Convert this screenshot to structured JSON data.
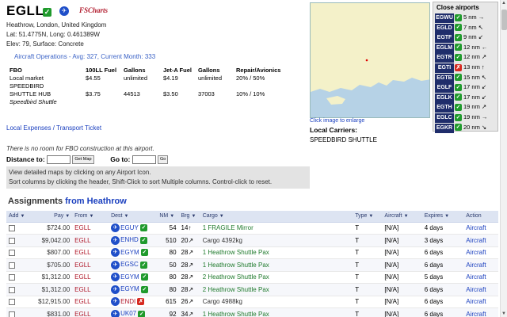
{
  "airport": {
    "icao": "EGLL",
    "fse_logo": "FSCharts",
    "name": "Heathrow, London, United Kingdom",
    "latlong": "Lat: 51.4775N, Long: 0.461389W",
    "elev": "Elev: 79, Surface: Concrete",
    "operations": "Aircraft Operations - Avg: 327, Current Month: 333"
  },
  "fbo": {
    "headers": [
      "FBO",
      "100LL Fuel",
      "Gallons",
      "Jet-A Fuel",
      "Gallons",
      "Repair/Avionics"
    ],
    "rows": [
      {
        "name": "Local market",
        "ll": "$4.55",
        "llg": "unlimited",
        "jet": "$4.19",
        "jetg": "unlimited",
        "repair": "20% / 50%"
      },
      {
        "name": "SPEEDBIRD",
        "ll": "",
        "llg": "",
        "jet": "",
        "jetg": "",
        "repair": ""
      },
      {
        "name": "SHUTTLE HUB",
        "ll": "$3.75",
        "llg": "44513",
        "jet": "$3.50",
        "jetg": "37003",
        "repair": "10% / 10%"
      },
      {
        "name": "Speedbird Shuttle",
        "ll": "",
        "llg": "",
        "jet": "",
        "jetg": "",
        "repair": ""
      }
    ],
    "links": "Local Expenses / Transport Ticket"
  },
  "map": {
    "caption": "Click image to enlarge",
    "carriers_label": "Local Carriers:",
    "carriers_value": "SPEEDBIRD SHUTTLE"
  },
  "close_airports": {
    "title": "Close airports",
    "items": [
      {
        "code": "EGWU",
        "status": "ok",
        "dist": "5 nm",
        "arrow": "→"
      },
      {
        "code": "EGLD",
        "status": "ok",
        "dist": "7 nm",
        "arrow": "↖"
      },
      {
        "code": "EGTF",
        "status": "ok",
        "dist": "9 nm",
        "arrow": "↙"
      },
      {
        "code": "EGLM",
        "status": "ok",
        "dist": "12 nm",
        "arrow": "←"
      },
      {
        "code": "EGTR",
        "status": "ok",
        "dist": "12 nm",
        "arrow": "↗"
      },
      {
        "code": "EGTI",
        "status": "x",
        "dist": "13 nm",
        "arrow": "↑"
      },
      {
        "code": "EGTB",
        "status": "ok",
        "dist": "15 nm",
        "arrow": "↖"
      },
      {
        "code": "EGLF",
        "status": "ok",
        "dist": "17 nm",
        "arrow": "↙"
      },
      {
        "code": "EGLK",
        "status": "ok",
        "dist": "17 nm",
        "arrow": "↙"
      },
      {
        "code": "EGTH",
        "status": "ok",
        "dist": "19 nm",
        "arrow": "↗"
      },
      {
        "code": "EGLC",
        "status": "ok",
        "dist": "19 nm",
        "arrow": "→"
      },
      {
        "code": "EGKR",
        "status": "ok",
        "dist": "20 nm",
        "arrow": "↘"
      }
    ]
  },
  "construction": {
    "notice": "There is no room for FBO construction at this airport.",
    "distance_label": "Distance to:",
    "get_map": "Get Map",
    "goto_label": "Go to:",
    "go": "Go",
    "help1": "View detailed maps by clicking on any Airport Icon.",
    "help2": "Sort columns by clicking the header, Shift-Click to sort Multiple columns. Control-click to reset."
  },
  "assignments": {
    "title_prefix": "Assignments",
    "title_link": "from Heathrow",
    "headers": [
      "Add",
      "Pay",
      "From",
      "Dest",
      "NM",
      "Brg",
      "Cargo",
      "Type",
      "Aircraft",
      "Expires",
      "Action"
    ],
    "rows": [
      {
        "pay": "$724.00",
        "from": "EGLL",
        "dest": "EGUY",
        "dest_status": "ok",
        "nm": "54",
        "brg": "14",
        "brg_arrow": "↑",
        "cargo": "1 FRAGILE Mirror",
        "cargo_link": true,
        "type": "T",
        "aircraft": "[N/A]",
        "expires": "4 days",
        "action": "Aircraft"
      },
      {
        "pay": "$9,042.00",
        "from": "EGLL",
        "dest": "ENHD",
        "dest_status": "ok",
        "nm": "510",
        "brg": "20",
        "brg_arrow": "↗",
        "cargo": "Cargo 4392kg",
        "cargo_link": false,
        "type": "T",
        "aircraft": "[N/A]",
        "expires": "3 days",
        "action": "Aircraft"
      },
      {
        "pay": "$807.00",
        "from": "EGLL",
        "dest": "EGYM",
        "dest_status": "ok",
        "nm": "80",
        "brg": "28",
        "brg_arrow": "↗",
        "cargo": "1 Heathrow Shuttle Pax",
        "cargo_link": true,
        "type": "T",
        "aircraft": "[N/A]",
        "expires": "6 days",
        "action": "Aircraft"
      },
      {
        "pay": "$705.00",
        "from": "EGLL",
        "dest": "EGSC",
        "dest_status": "ok",
        "nm": "50",
        "brg": "28",
        "brg_arrow": "↗",
        "cargo": "1 Heathrow Shuttle Pax",
        "cargo_link": true,
        "type": "T",
        "aircraft": "[N/A]",
        "expires": "6 days",
        "action": "Aircraft"
      },
      {
        "pay": "$1,312.00",
        "from": "EGLL",
        "dest": "EGYM",
        "dest_status": "ok",
        "nm": "80",
        "brg": "28",
        "brg_arrow": "↗",
        "cargo": "2 Heathrow Shuttle Pax",
        "cargo_link": true,
        "type": "T",
        "aircraft": "[N/A]",
        "expires": "5 days",
        "action": "Aircraft"
      },
      {
        "pay": "$1,312.00",
        "from": "EGLL",
        "dest": "EGYM",
        "dest_status": "ok",
        "nm": "80",
        "brg": "28",
        "brg_arrow": "↗",
        "cargo": "2 Heathrow Shuttle Pax",
        "cargo_link": true,
        "type": "T",
        "aircraft": "[N/A]",
        "expires": "6 days",
        "action": "Aircraft"
      },
      {
        "pay": "$12,915.00",
        "from": "EGLL",
        "dest": "ENDI",
        "dest_status": "x",
        "nm": "615",
        "brg": "26",
        "brg_arrow": "↗",
        "cargo": "Cargo 4988kg",
        "cargo_link": false,
        "type": "T",
        "aircraft": "[N/A]",
        "expires": "6 days",
        "action": "Aircraft"
      },
      {
        "pay": "$831.00",
        "from": "EGLL",
        "dest": "UK07",
        "dest_status": "ok",
        "nm": "92",
        "brg": "34",
        "brg_arrow": "↗",
        "cargo": "1 Heathrow Shuttle Pax",
        "cargo_link": true,
        "type": "T",
        "aircraft": "[N/A]",
        "expires": "6 days",
        "action": "Aircraft"
      }
    ]
  }
}
